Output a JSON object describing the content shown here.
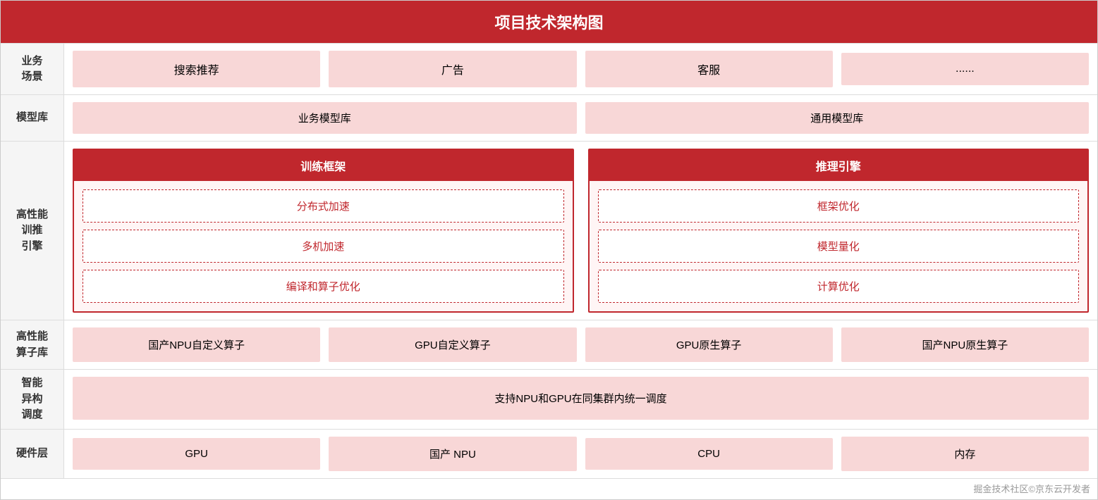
{
  "title": "项目技术架构图",
  "rows": [
    {
      "label": "业务\n场景",
      "items": [
        "搜索推荐",
        "广告",
        "客服",
        "......"
      ]
    },
    {
      "label": "模型库",
      "items": [
        "业务模型库",
        "通用模型库"
      ]
    },
    {
      "label": "高性能\n训推\n引擎",
      "blocks": [
        {
          "header": "训练框架",
          "sub_items": [
            "分布式加速",
            "多机加速",
            "编译和算子优化"
          ]
        },
        {
          "header": "推理引擎",
          "sub_items": [
            "框架优化",
            "模型量化",
            "计算优化"
          ]
        }
      ]
    },
    {
      "label": "高性能\n算子库",
      "items": [
        "国产NPU自定义算子",
        "GPU自定义算子",
        "GPU原生算子",
        "国产NPU原生算子"
      ]
    },
    {
      "label": "智能\n异构\n调度",
      "items": [
        "支持NPU和GPU在同集群内统一调度"
      ]
    },
    {
      "label": "硬件层",
      "items": [
        "GPU",
        "国产 NPU",
        "CPU",
        "内存"
      ]
    }
  ],
  "watermark": "掘金技术社区©京东云开发者"
}
